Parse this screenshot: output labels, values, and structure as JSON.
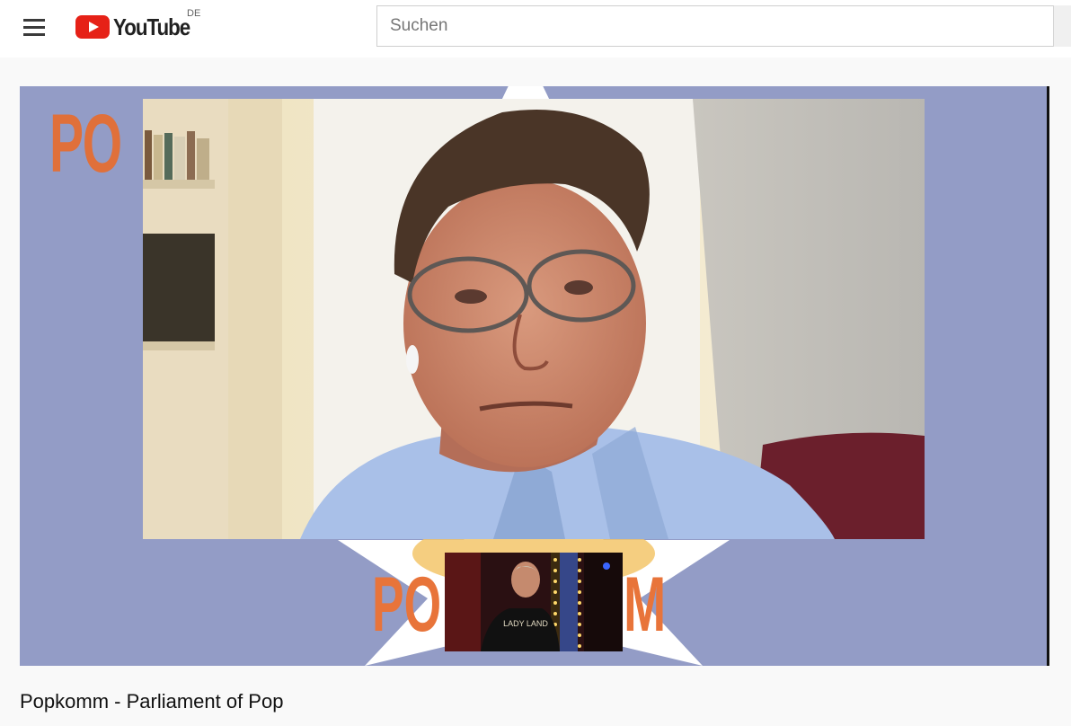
{
  "masthead": {
    "logo_text": "YouTube",
    "country_code": "DE",
    "search": {
      "placeholder": "Suchen",
      "value": ""
    }
  },
  "player": {
    "overlay_text_left": "PO",
    "overlay_text_bottom_left": "PO",
    "overlay_text_bottom_right": "M",
    "pip_shirt_text": "LADY LAND"
  },
  "video": {
    "title": "Popkomm - Parliament of Pop"
  },
  "colors": {
    "brand_red": "#e62117",
    "player_background": "#939cc6",
    "popkomm_orange": "#e0703a",
    "star_white": "#ffffff"
  },
  "icons": {
    "menu": "hamburger-menu-icon",
    "logo": "youtube-play-icon"
  }
}
